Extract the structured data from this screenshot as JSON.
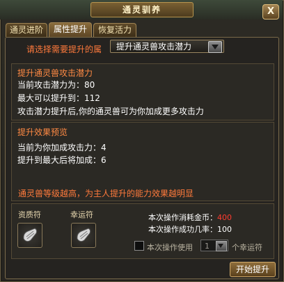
{
  "window": {
    "title": "通灵驯养",
    "close_label": "X"
  },
  "tabs": [
    {
      "label": "通灵进阶",
      "active": false
    },
    {
      "label": "属性提升",
      "active": true
    },
    {
      "label": "恢复活力",
      "active": false
    }
  ],
  "selector": {
    "label": "请选择需要提升的属",
    "selected": "提升通灵兽攻击潜力"
  },
  "attribute_panel": {
    "title": "提升通灵兽攻击潜力",
    "current": "当前攻击潜力为：80",
    "max": "最大可以提升到：112",
    "desc": "攻击潜力提升后,你的通灵兽可为你加成更多攻击力"
  },
  "preview_panel": {
    "title": "提升效果预览",
    "current_bonus": "当前为你加成攻击力：4",
    "max_bonus": "提升到最大后将加成：6"
  },
  "hint": "通灵兽等级越高，为主人提升的能力效果越明显",
  "items": {
    "slot1_label": "资质符",
    "slot1_icon": "scroll-icon",
    "slot2_label": "幸运符",
    "slot2_icon": "scroll-icon"
  },
  "operation": {
    "cost_label": "本次操作消耗金币：",
    "cost_value": "400",
    "success_label": "本次操作成功几率：100",
    "use_label": "本次操作使用",
    "use_count": "1",
    "use_suffix": "个幸运符"
  },
  "start_button": "开始提升",
  "colors": {
    "accent_orange": "#ff7a3c",
    "cost_red": "#ff3b2f",
    "border_gold": "#b8954f"
  }
}
